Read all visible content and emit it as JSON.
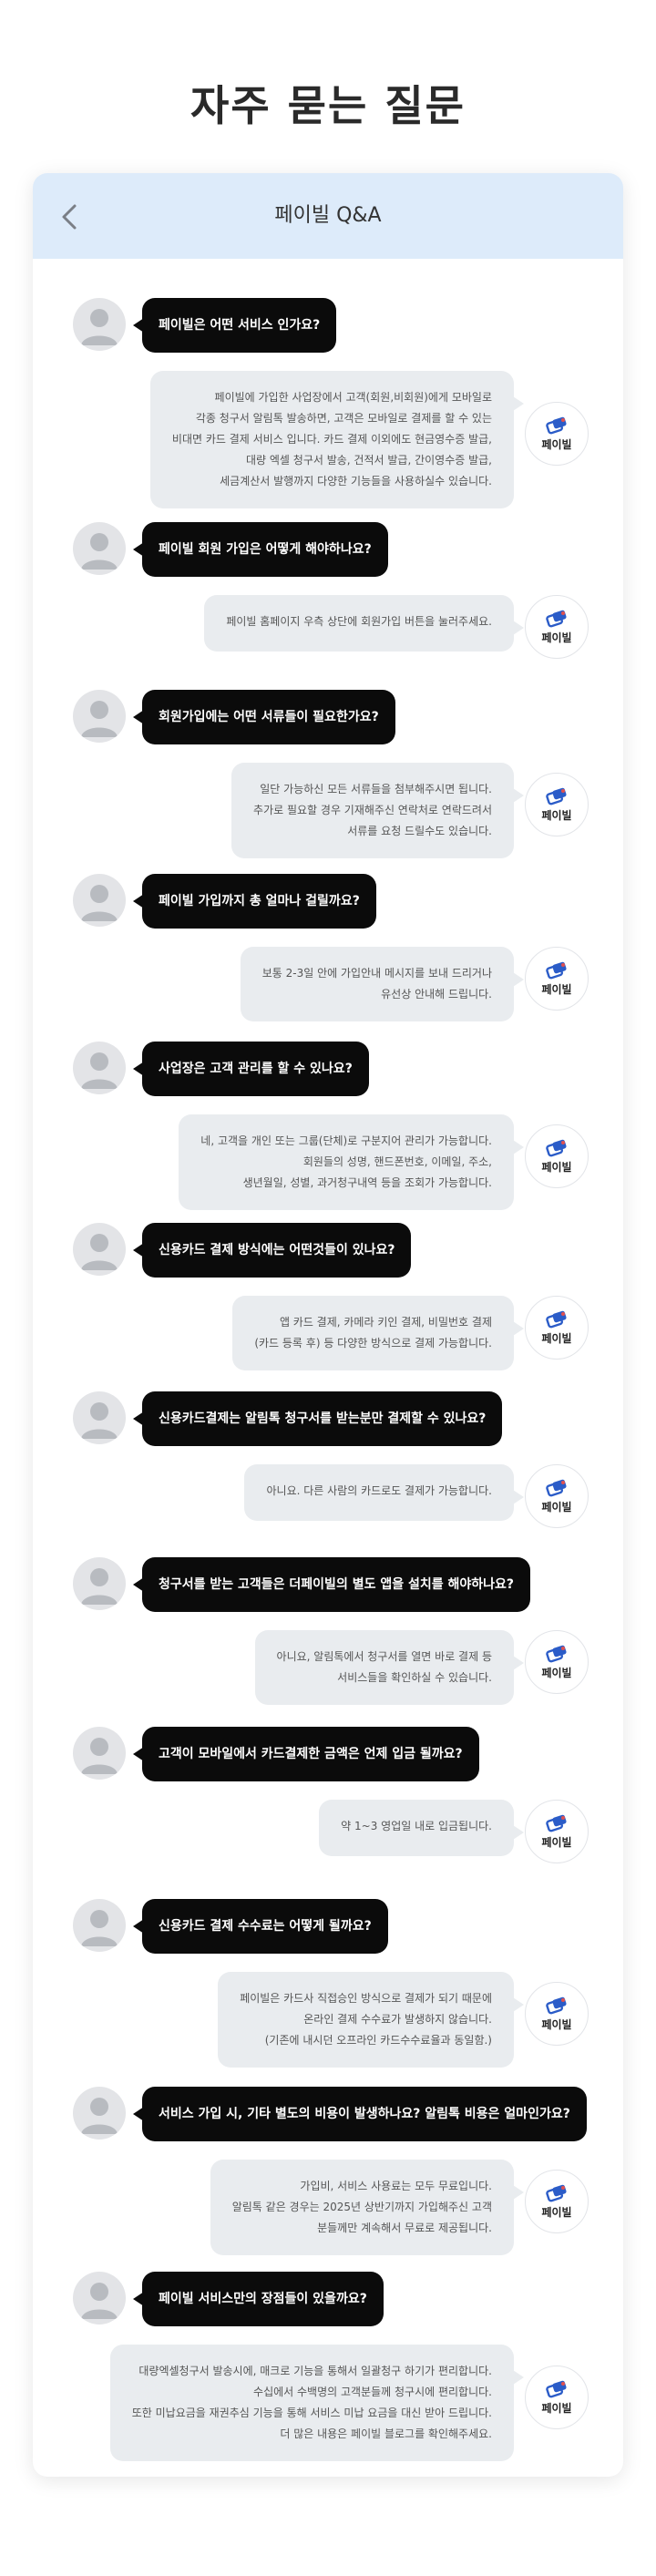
{
  "page": {
    "title": "자주 묻는 질문"
  },
  "header": {
    "title": "페이빌 Q&A",
    "back_icon": "chevron-left-icon"
  },
  "bot": {
    "name": "페이빌",
    "logo_color": "#2b5cc8",
    "logo_accent": "#e05050"
  },
  "qa": [
    {
      "question": "페이빌은 어떤 서비스 인가요?",
      "answer": "페이빌에 가입한 사업장에서 고객(회원,비회원)에게 모바일로\n각종 청구서 알림톡 발송하면, 고객은 모바일로 결제를 할 수 있는\n비대면 카드 결제 서비스 입니다. 카드 결제 이외에도 현금영수증 발급,\n대량 엑셀 청구서 발송, 건적서 발급, 간이영수증 발급,\n세금계산서 발행까지 다양한 기능들을 사용하실수 있습니다."
    },
    {
      "question": "페이빌 회원 가입은 어떻게 해야하나요?",
      "answer": "페이빌 홈페이지 우측 상단에 회원가입 버튼을 눌러주세요."
    },
    {
      "question": "회원가입에는 어떤 서류들이 필요한가요?",
      "answer": "일단 가능하신 모든 서류들을 첨부해주시면 됩니다.\n추가로 필요할 경우 기재해주신 연락처로 연락드려서\n서류를 요청 드릴수도 있습니다."
    },
    {
      "question": "페이빌 가입까지 총 얼마나 걸릴까요?",
      "answer": "보통 2-3일 안에 가입안내 메시지를 보내 드리거나\n유선상 안내해 드립니다."
    },
    {
      "question": "사업장은 고객 관리를 할 수 있나요?",
      "answer": "네, 고객을 개인 또는 그룹(단체)로 구분지어 관리가 가능합니다.\n회원들의 성명, 핸드폰번호, 이메일, 주소,\n생년월일, 성별, 과거청구내역 등을 조회가 가능합니다."
    },
    {
      "question": "신용카드 결제 방식에는 어떤것들이 있나요?",
      "answer": "앱 카드 결제, 카메라 키인 결제, 비밀번호 결제\n(카드 등록 후) 등 다양한 방식으로 결제 가능합니다."
    },
    {
      "question": "신용카드결제는 알림톡 청구서를 받는분만 결제할 수 있나요?",
      "answer": "아니요. 다른 사람의 카드로도 결제가 가능합니다."
    },
    {
      "question": "청구서를 받는 고객들은 더페이빌의 별도 앱을 설치를 해야하나요?",
      "answer": "아니요, 알림톡에서 청구서를 열면 바로 결제 등\n서비스들을 확인하실 수 있습니다."
    },
    {
      "question": "고객이 모바일에서 카드결제한 금액은 언제 입금 될까요?",
      "answer": "약 1~3 영업일 내로 입금됩니다."
    },
    {
      "question": "신용카드 결제 수수료는 어떻게 될까요?",
      "answer": "페이빌은 카드사 직접승인 방식으로 결제가 되기 때문에\n온라인 결제 수수료가 발생하지 않습니다.\n(기존에 내시던 오프라인 카드수수료율과 동일함.)"
    },
    {
      "question": "서비스 가입 시, 기타 별도의 비용이 발생하나요? 알림톡 비용은 얼마인가요?",
      "answer": "가입비, 서비스 사용료는 모두 무료입니다.\n알림톡 같은 경우는 2025년 상반기까지 가입해주신 고객\n분들께만 계속해서 무료로 제공됩니다."
    },
    {
      "question": "페이빌 서비스만의 장점들이 있을까요?",
      "answer": "대량엑셀청구서 발송시에, 매크로 기능을 통해서 일괄청구 하기가 편리합니다.\n수십에서 수백명의 고객분들께 청구시에 편리합니다.\n또한 미납요금을 재권추심 기능을 통해 서비스 미납 요금을 대신 받아 드립니다.\n더 많은 내용은 페이빌 블로그를 확인해주세요."
    }
  ]
}
